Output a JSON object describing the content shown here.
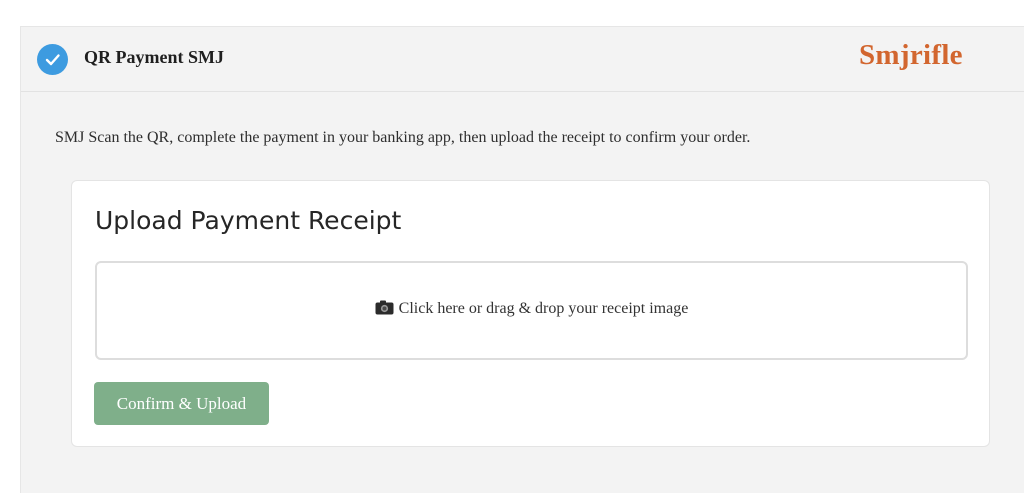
{
  "header": {
    "title": "QR Payment SMJ",
    "brand": "Smjrifle",
    "status_icon": "check-circle-icon",
    "status_color": "#3d9be0",
    "brand_color": "#d2662f"
  },
  "instructions": "SMJ Scan the QR, complete the payment in your banking app, then upload the receipt to confirm your order.",
  "upload_card": {
    "title": "Upload Payment Receipt",
    "dropzone": {
      "icon": "camera-icon",
      "text": "Click here or drag & drop your receipt image"
    },
    "confirm_button": {
      "label": "Confirm & Upload",
      "color": "#7faf8a"
    }
  }
}
